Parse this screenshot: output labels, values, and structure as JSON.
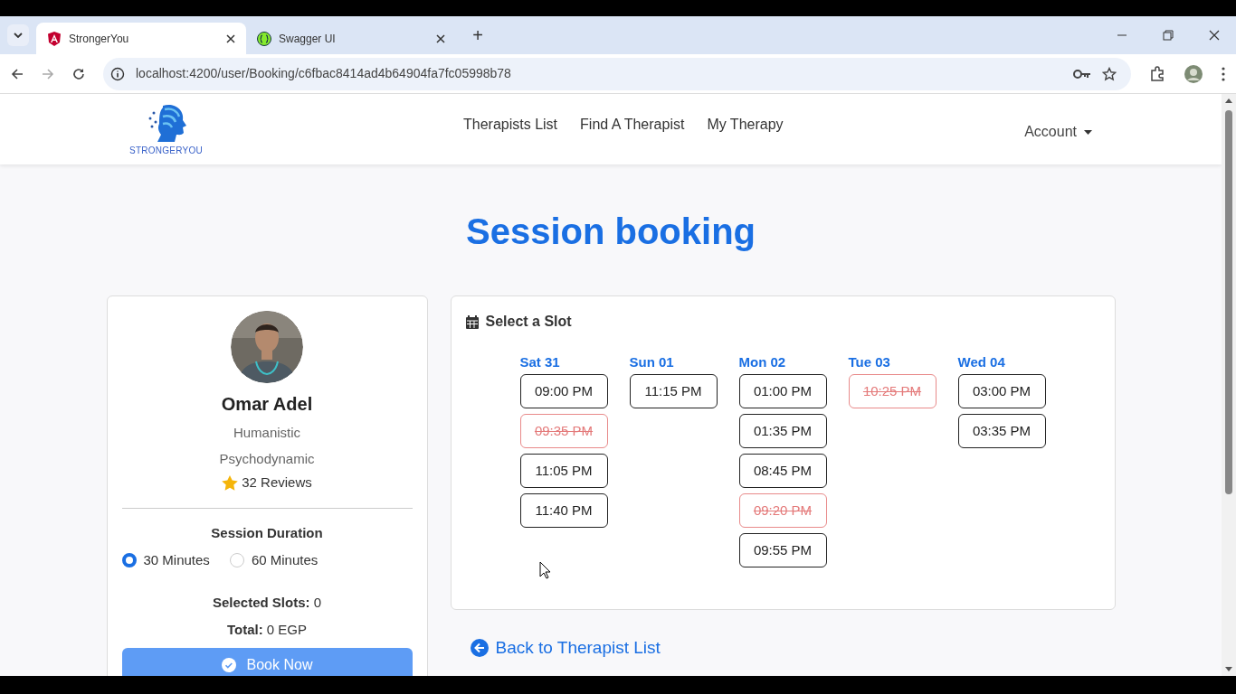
{
  "browser": {
    "tabs": [
      {
        "title": "StrongerYou",
        "selected": true,
        "kind": "angular"
      },
      {
        "title": "Swagger UI",
        "selected": false,
        "kind": "swagger"
      }
    ],
    "new_tab": "+",
    "url": "localhost:4200/user/Booking/c6fbac8414ad4b64904fa7fc05998b78"
  },
  "navbar": {
    "logo_text": "STRONGERYOU",
    "links": [
      "Therapists List",
      "Find A Therapist",
      "My Therapy"
    ],
    "account": "Account"
  },
  "heading": "Session booking",
  "therapist": {
    "name": "Omar Adel",
    "specialties": [
      "Humanistic",
      "Psychodynamic"
    ],
    "reviews": "32 Reviews",
    "duration_label": "Session Duration",
    "durations": [
      {
        "label": "30 Minutes",
        "selected": true
      },
      {
        "label": "60 Minutes",
        "selected": false
      }
    ],
    "selected_slots": "**Selected Slots:** 0",
    "total": "**Total:** 0 EGP",
    "book_button": "Book Now"
  },
  "slots": {
    "title": "Select a Slot",
    "days": [
      {
        "label": "Sat 31",
        "slots": [
          {
            "time": "09:00 PM",
            "booked": false
          },
          {
            "time": "09:35 PM",
            "booked": true
          },
          {
            "time": "11:05 PM",
            "booked": false
          },
          {
            "time": "11:40 PM",
            "booked": false
          }
        ]
      },
      {
        "label": "Sun 01",
        "slots": [
          {
            "time": "11:15 PM",
            "booked": false
          }
        ]
      },
      {
        "label": "Mon 02",
        "slots": [
          {
            "time": "01:00 PM",
            "booked": false
          },
          {
            "time": "01:35 PM",
            "booked": false
          },
          {
            "time": "08:45 PM",
            "booked": false
          },
          {
            "time": "09:20 PM",
            "booked": true
          },
          {
            "time": "09:55 PM",
            "booked": false
          }
        ]
      },
      {
        "label": "Tue 03",
        "slots": [
          {
            "time": "10:25 PM",
            "booked": true
          }
        ]
      },
      {
        "label": "Wed 04",
        "slots": [
          {
            "time": "03:00 PM",
            "booked": false
          },
          {
            "time": "03:35 PM",
            "booked": false
          }
        ]
      }
    ]
  },
  "back_link": "Back to Therapist List"
}
